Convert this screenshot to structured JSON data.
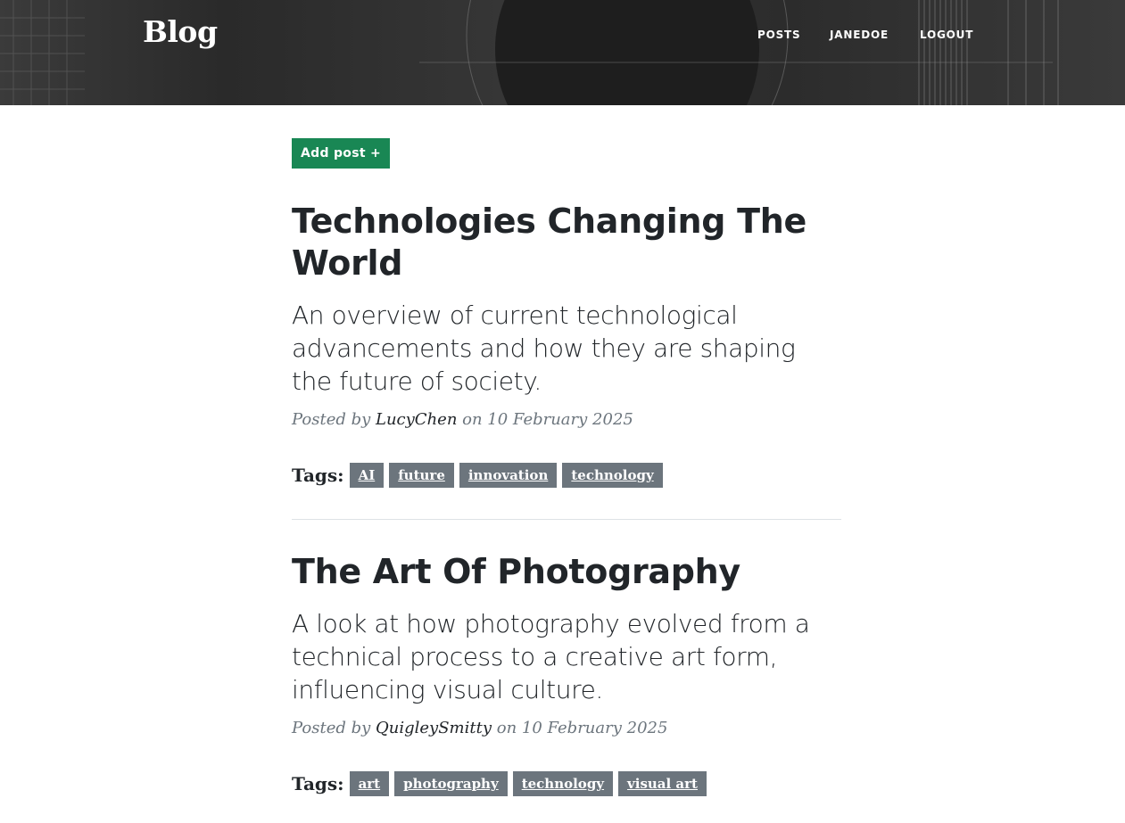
{
  "header": {
    "brand": "Blog",
    "nav": [
      "POSTS",
      "JANEDOE",
      "LOGOUT"
    ]
  },
  "main": {
    "add_post_label": "Add post +",
    "posts": [
      {
        "title": "Technologies Changing The World",
        "subtitle": "An overview of current technological advancements and how they are shaping the future of society.",
        "posted_by": "Posted by",
        "author": "LucyChen",
        "date_text": "on 10 February 2025",
        "tags_label": "Tags:",
        "tags": [
          "AI",
          "future",
          "innovation",
          "technology"
        ]
      },
      {
        "title": "The Art Of Photography",
        "subtitle": "A look at how photography evolved from a technical process to a creative art form, influencing visual culture.",
        "posted_by": "Posted by",
        "author": "QuigleySmitty",
        "date_text": "on 10 February 2025",
        "tags_label": "Tags:",
        "tags": [
          "art",
          "photography",
          "technology",
          "visual art"
        ]
      }
    ]
  },
  "colors": {
    "accent_button": "#198754",
    "tag_background": "#6c757d",
    "text": "#212529",
    "muted": "#6c757d"
  }
}
